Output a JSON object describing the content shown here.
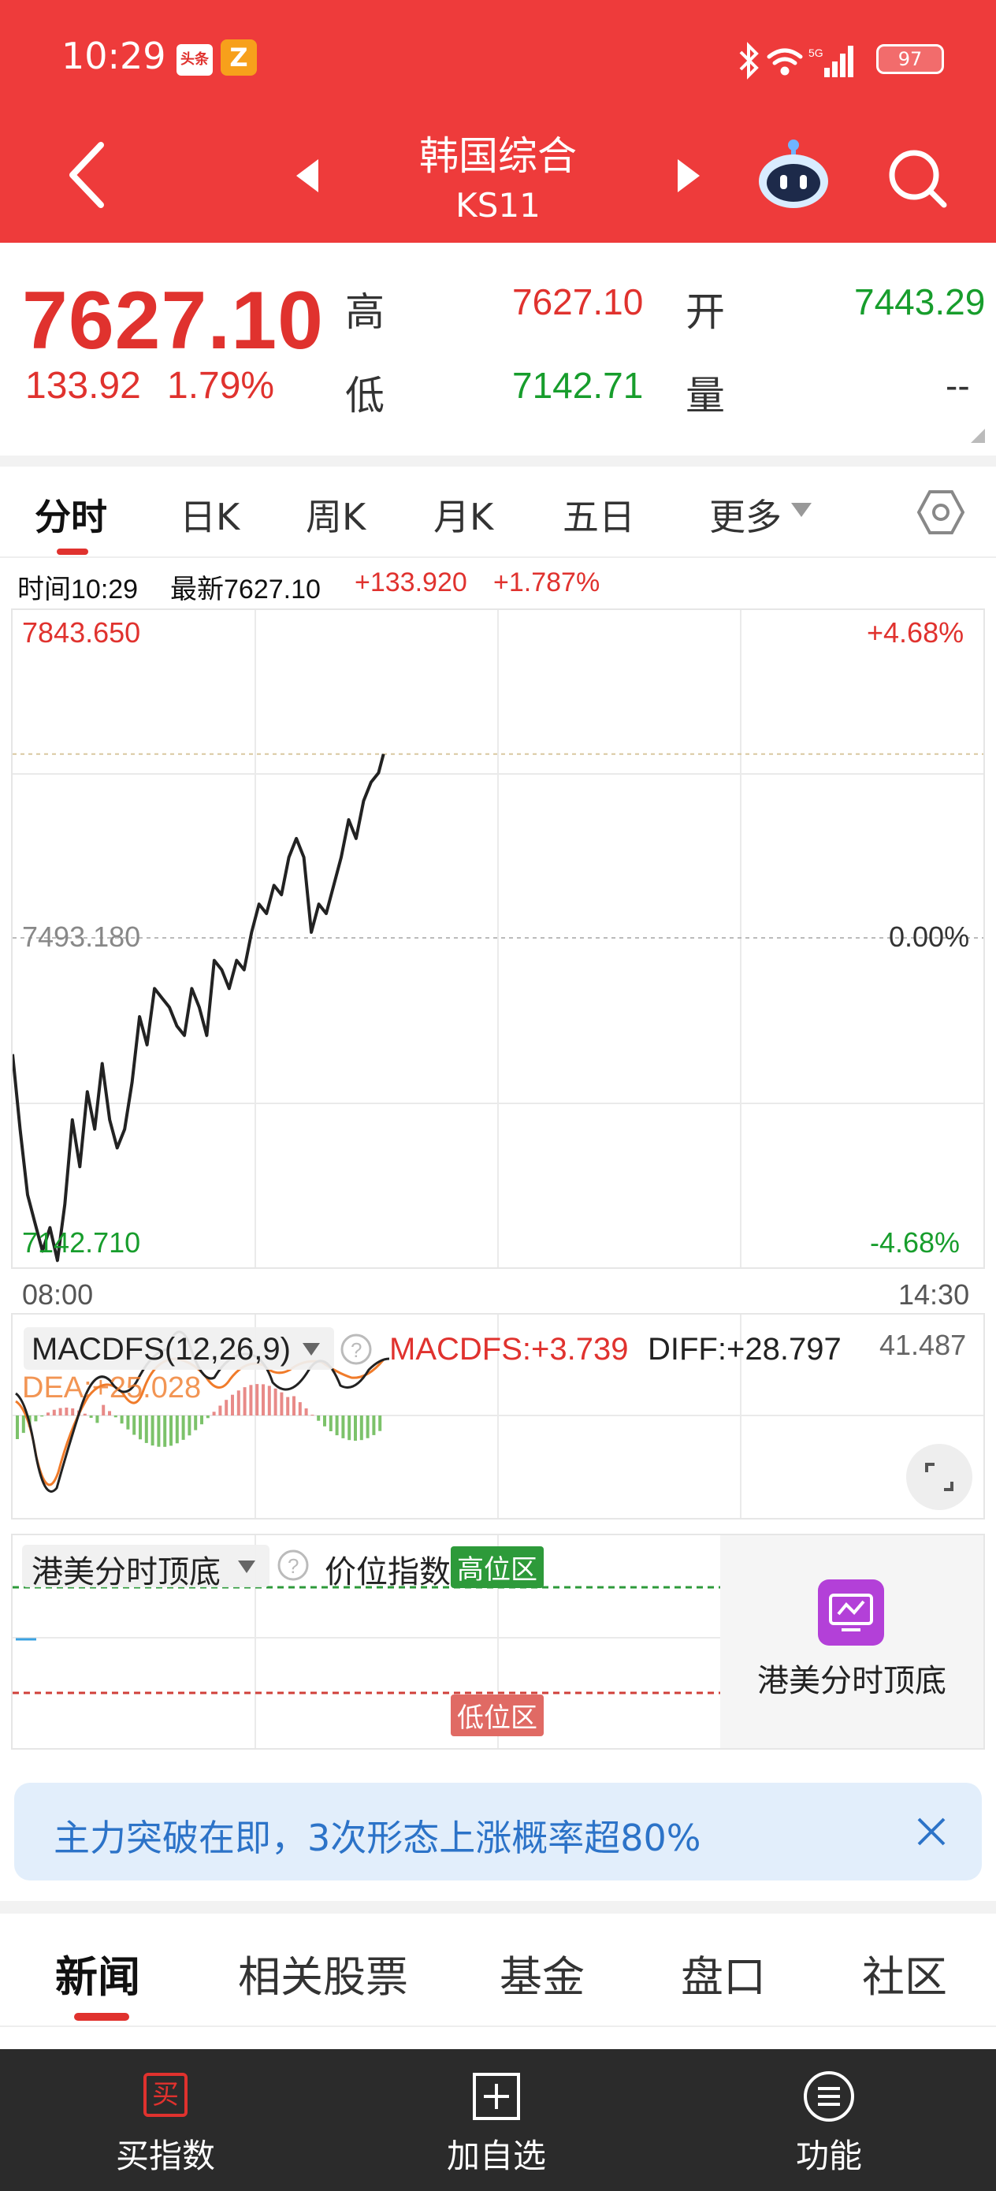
{
  "status_bar": {
    "time": "10:29",
    "app_icon_1": "头条",
    "app_icon_2": "Z",
    "network": "5G",
    "battery": "97"
  },
  "header": {
    "title": "韩国综合",
    "code": "KS11"
  },
  "quote": {
    "price": "7627.10",
    "change": "133.92",
    "change_pct": "1.79%",
    "high_label": "高",
    "high": "7627.10",
    "low_label": "低",
    "low": "7142.71",
    "open_label": "开",
    "open": "7443.29",
    "volume_label": "量",
    "volume": "--"
  },
  "chart_tabs": [
    "分时",
    "日K",
    "周K",
    "月K",
    "五日",
    "更多"
  ],
  "info_line": {
    "time": "时间10:29",
    "latest": "最新7627.10",
    "change": "+133.920",
    "change_pct": "+1.787%"
  },
  "chart_axis": {
    "top_price": "7843.650",
    "top_pct": "+4.68%",
    "mid_price": "7493.180",
    "mid_pct": "0.00%",
    "bottom_price": "7142.710",
    "bottom_pct": "-4.68%",
    "start_time": "08:00",
    "end_time": "14:30"
  },
  "macd": {
    "name": "MACDFS(12,26,9)",
    "macdfs": "MACDFS:+3.739",
    "diff": "DIFF:+28.797",
    "dea": "DEA:+25.028",
    "top_value": "41.487"
  },
  "indicator": {
    "name": "港美分时顶底",
    "sub": "价位指数",
    "high_zone": "高位区",
    "low_zone": "低位区",
    "side_card": "港美分时顶底"
  },
  "banner": {
    "text": "主力突破在即，3次形态上涨概率超80%"
  },
  "news_tabs": [
    "新闻",
    "相关股票",
    "基金",
    "盘口",
    "社区"
  ],
  "footer": {
    "buy": "买指数",
    "buy_icon_text": "买",
    "add": "加自选",
    "func": "功能"
  },
  "colors": {
    "header_red": "#ee3b3b",
    "up_red": "#e0322e",
    "down_green": "#179d2c",
    "dea_orange": "#f07b2a",
    "banner_blue": "#2c73c8"
  },
  "chart_data": {
    "type": "line",
    "title": "",
    "x_range": [
      "08:00",
      "14:30"
    ],
    "ylim": [
      7142.71,
      7843.65
    ],
    "x": [
      "08:00",
      "08:03",
      "08:06",
      "08:09",
      "08:12",
      "08:15",
      "08:18",
      "08:21",
      "08:24",
      "08:27",
      "08:30",
      "08:33",
      "08:36",
      "08:39",
      "08:42",
      "08:45",
      "08:48",
      "08:51",
      "08:54",
      "08:57",
      "09:00",
      "09:03",
      "09:06",
      "09:09",
      "09:12",
      "09:15",
      "09:18",
      "09:21",
      "09:24",
      "09:27",
      "09:30",
      "09:33",
      "09:36",
      "09:39",
      "09:42",
      "09:45",
      "09:48",
      "09:51",
      "09:54",
      "09:57",
      "10:00",
      "10:03",
      "10:06",
      "10:09",
      "10:12",
      "10:15",
      "10:18",
      "10:21",
      "10:24",
      "10:27",
      "10:29"
    ],
    "series": [
      {
        "values": [
          7370,
          7290,
          7220,
          7190,
          7160,
          7185,
          7150,
          7210,
          7300,
          7250,
          7330,
          7290,
          7360,
          7300,
          7270,
          7290,
          7340,
          7410,
          7380,
          7440,
          7430,
          7420,
          7400,
          7390,
          7440,
          7420,
          7390,
          7470,
          7460,
          7440,
          7470,
          7460,
          7500,
          7530,
          7520,
          7550,
          7540,
          7580,
          7600,
          7580,
          7500,
          7530,
          7520,
          7550,
          7580,
          7620,
          7600,
          7640,
          7660,
          7670,
          7690
        ]
      }
    ]
  }
}
